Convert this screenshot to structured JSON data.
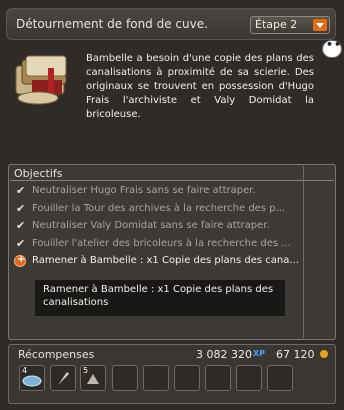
{
  "header": {
    "title": "Détournement de fond de cuve.",
    "step_label": "Étape 2"
  },
  "bubble": {
    "text": "•••"
  },
  "quest": {
    "icon": "scroll-books-icon",
    "description": "Bambelle a besoin d'une copie des plans des canalisations à proximité de sa scierie. Des originaux se trouvent en possession d'Hugo Frais l'archiviste et Valy Domidat la bricoleuse."
  },
  "objectives": {
    "title": "Objectifs",
    "items": [
      {
        "text": "Neutraliser Hugo Frais sans se faire attraper.",
        "done": true
      },
      {
        "text": "Fouiller la Tour des archives à la recherche des p...",
        "done": true
      },
      {
        "text": "Neutraliser Valy Domidat sans se faire attraper.",
        "done": true
      },
      {
        "text": "Fouiller l'atelier des bricoleurs à la recherche des ...",
        "done": true
      },
      {
        "text": "Ramener à Bambelle : x1 Copie des plans des cana...",
        "done": false
      }
    ],
    "tooltip": "Ramener à Bambelle : x1 Copie des plans des canalisations"
  },
  "rewards": {
    "title": "Récompenses",
    "xp": "3 082 320",
    "xp_icon": "XP",
    "kamas": "67 120",
    "slots": [
      {
        "icon": "dish-icon",
        "qty": "4"
      },
      {
        "icon": "feather-icon",
        "qty": ""
      },
      {
        "icon": "potion-icon",
        "qty": "5"
      },
      {
        "icon": "",
        "qty": ""
      },
      {
        "icon": "",
        "qty": ""
      },
      {
        "icon": "",
        "qty": ""
      },
      {
        "icon": "",
        "qty": ""
      },
      {
        "icon": "",
        "qty": ""
      },
      {
        "icon": "",
        "qty": ""
      }
    ]
  }
}
